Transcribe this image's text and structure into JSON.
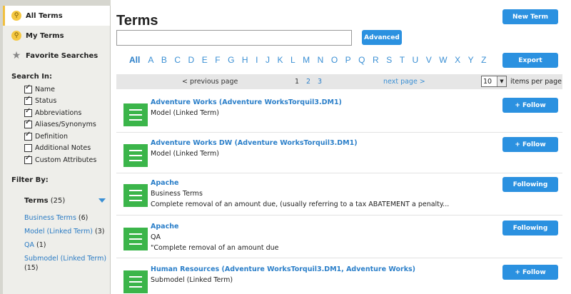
{
  "sidebar": {
    "nav": [
      {
        "label": "All Terms",
        "icon": "search-icon"
      },
      {
        "label": "My Terms",
        "icon": "search-icon"
      },
      {
        "label": "Favorite Searches",
        "icon": "star-icon"
      }
    ],
    "search_in_heading": "Search In:",
    "search_in": [
      {
        "label": "Name",
        "checked": true
      },
      {
        "label": "Status",
        "checked": true
      },
      {
        "label": "Abbreviations",
        "checked": true
      },
      {
        "label": "Aliases/Synonyms",
        "checked": true
      },
      {
        "label": "Definition",
        "checked": true
      },
      {
        "label": "Additional Notes",
        "checked": false
      },
      {
        "label": "Custom Attributes",
        "checked": true
      }
    ],
    "filter_heading": "Filter By:",
    "filter_terms_label": "Terms",
    "filter_terms_count": "(25)",
    "filters": [
      {
        "label": "Business Terms",
        "count": "(6)"
      },
      {
        "label": "Model (Linked Term)",
        "count": "(3)"
      },
      {
        "label": "QA",
        "count": "(1)"
      },
      {
        "label": "Submodel (Linked Term)",
        "count": "(15)"
      }
    ]
  },
  "main": {
    "title": "Terms",
    "new_term_label": "New Term",
    "advanced_label": "Advanced",
    "export_label": "Export",
    "search_value": "",
    "alphabet_all": "All",
    "alphabet": [
      "A",
      "B",
      "C",
      "D",
      "E",
      "F",
      "G",
      "H",
      "I",
      "J",
      "K",
      "L",
      "M",
      "N",
      "O",
      "P",
      "Q",
      "R",
      "S",
      "T",
      "U",
      "V",
      "W",
      "X",
      "Y",
      "Z"
    ],
    "pager": {
      "prev": "< previous page",
      "pages": [
        "1",
        "2",
        "3"
      ],
      "current": "1",
      "next": "next page >",
      "per_page_value": "10",
      "per_page_label": "items per page"
    },
    "rows": [
      {
        "name": "Adventure Works (Adventure WorksTorquil3.DM1)",
        "type": "Model (Linked Term)",
        "definition": "",
        "action": "+ Follow"
      },
      {
        "name": "Adventure Works DW (Adventure WorksTorquil3.DM1)",
        "type": "Model (Linked Term)",
        "definition": "",
        "action": "+ Follow"
      },
      {
        "name": "Apache",
        "type": "Business Terms",
        "definition": "Complete removal of an amount due, (usually referring to a tax ABATEMENT a penalty...",
        "action": "Following"
      },
      {
        "name": "Apache",
        "type": "QA",
        "definition": "\"Complete removal of an amount due",
        "action": "Following"
      },
      {
        "name": "Human Resources (Adventure WorksTorquil3.DM1, Adventure Works)",
        "type": "Submodel (Linked Term)",
        "definition": "",
        "action": "+ Follow"
      }
    ]
  },
  "colors": {
    "accent": "#2b91e0",
    "link": "#2b7fc9",
    "term_icon": "#3bb54a",
    "sidebar_bg": "#eeeeea",
    "frame_bg": "#d6d6cf"
  }
}
